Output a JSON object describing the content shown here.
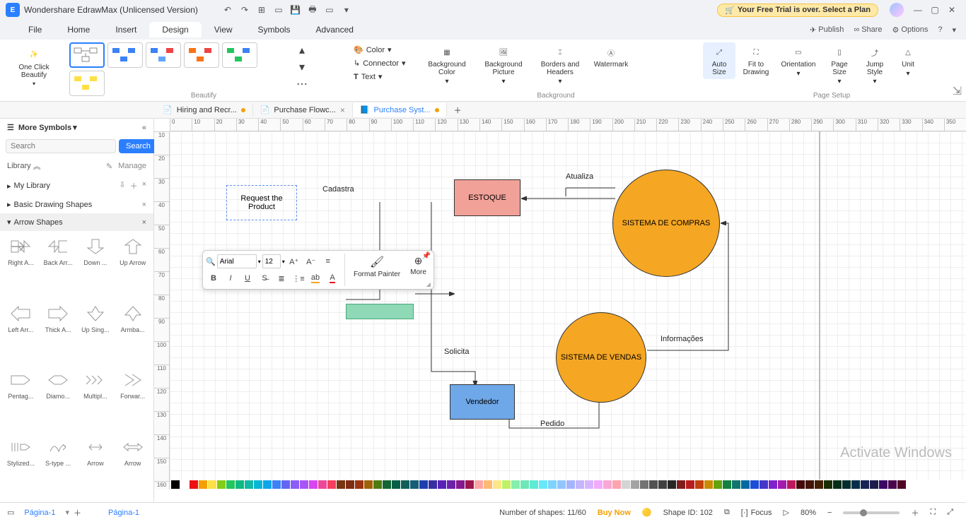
{
  "title": "Wondershare EdrawMax (Unlicensed Version)",
  "trial": {
    "text": "Your Free Trial is over. Select a Plan"
  },
  "menus": [
    "File",
    "Home",
    "Insert",
    "Design",
    "View",
    "Symbols",
    "Advanced"
  ],
  "activeMenu": "Design",
  "menubarRight": {
    "publish": "Publish",
    "share": "Share",
    "options": "Options"
  },
  "ribbon": {
    "beautify": {
      "btn": "One Click Beautify",
      "group": "Beautify"
    },
    "smallMenu": {
      "color": "Color",
      "connector": "Connector",
      "text": "Text"
    },
    "bg": {
      "color": "Background Color",
      "picture": "Background Picture",
      "borders": "Borders and Headers",
      "watermark": "Watermark",
      "group": "Background"
    },
    "page": {
      "autosize": "Auto Size",
      "fit": "Fit to Drawing",
      "orientation": "Orientation",
      "size": "Page Size",
      "jump": "Jump Style",
      "unit": "Unit",
      "group": "Page Setup"
    }
  },
  "docTabs": [
    {
      "label": "Hiring and Recr...",
      "modified": true
    },
    {
      "label": "Purchase Flowc...",
      "modified": false
    },
    {
      "label": "Purchase Syst...",
      "modified": true,
      "active": true
    }
  ],
  "leftPanel": {
    "header": "More Symbols",
    "searchPlaceholder": "Search",
    "searchBtn": "Search",
    "library": "Library",
    "manage": "Manage",
    "myLibrary": "My Library",
    "basic": "Basic Drawing Shapes",
    "arrowHeader": "Arrow Shapes",
    "shapes": [
      {
        "n": "Right A..."
      },
      {
        "n": "Back Arr..."
      },
      {
        "n": "Down ..."
      },
      {
        "n": "Up Arrow"
      },
      {
        "n": "Left Arr..."
      },
      {
        "n": "Thick A..."
      },
      {
        "n": "Up Sing..."
      },
      {
        "n": "Armba..."
      },
      {
        "n": "Pentag..."
      },
      {
        "n": "Diamo..."
      },
      {
        "n": "Multipl..."
      },
      {
        "n": "Forwar..."
      },
      {
        "n": "Stylized..."
      },
      {
        "n": "S-type ..."
      },
      {
        "n": "Arrow"
      },
      {
        "n": "Arrow"
      }
    ]
  },
  "diagram": {
    "request": "Request the Product",
    "cadastra": "Cadastra",
    "estoque": "ESTOQUE",
    "atualiza": "Atualiza",
    "compras": "SISTEMA DE COMPRAS",
    "solicita": "Solicita",
    "vendedor": "Vendedor",
    "pedido": "Pedido",
    "vendas": "SISTEMA DE VENDAS",
    "informacoes": "Informações"
  },
  "formatToolbar": {
    "font": "Arial",
    "size": "12",
    "painter": "Format Painter",
    "more": "More"
  },
  "statusbar": {
    "pageTab": "Página-1",
    "pageTab2": "Página-1",
    "shapes": "Number of shapes: 11/60",
    "buy": "Buy Now",
    "shapeId": "Shape ID: 102",
    "focus": "Focus",
    "zoom": "80%"
  },
  "watermark": "Activate Windows",
  "rulerH": [
    0,
    10,
    20,
    30,
    40,
    50,
    60,
    70,
    80,
    90,
    100,
    110,
    120,
    130,
    140,
    150,
    160,
    170,
    180,
    190,
    200,
    210,
    220,
    230,
    240,
    250,
    260,
    270,
    280,
    290,
    300,
    310,
    320,
    330,
    340,
    350
  ],
  "rulerV": [
    10,
    20,
    30,
    40,
    50,
    60,
    70,
    80,
    90,
    100,
    110,
    120,
    130,
    140,
    150,
    160
  ]
}
